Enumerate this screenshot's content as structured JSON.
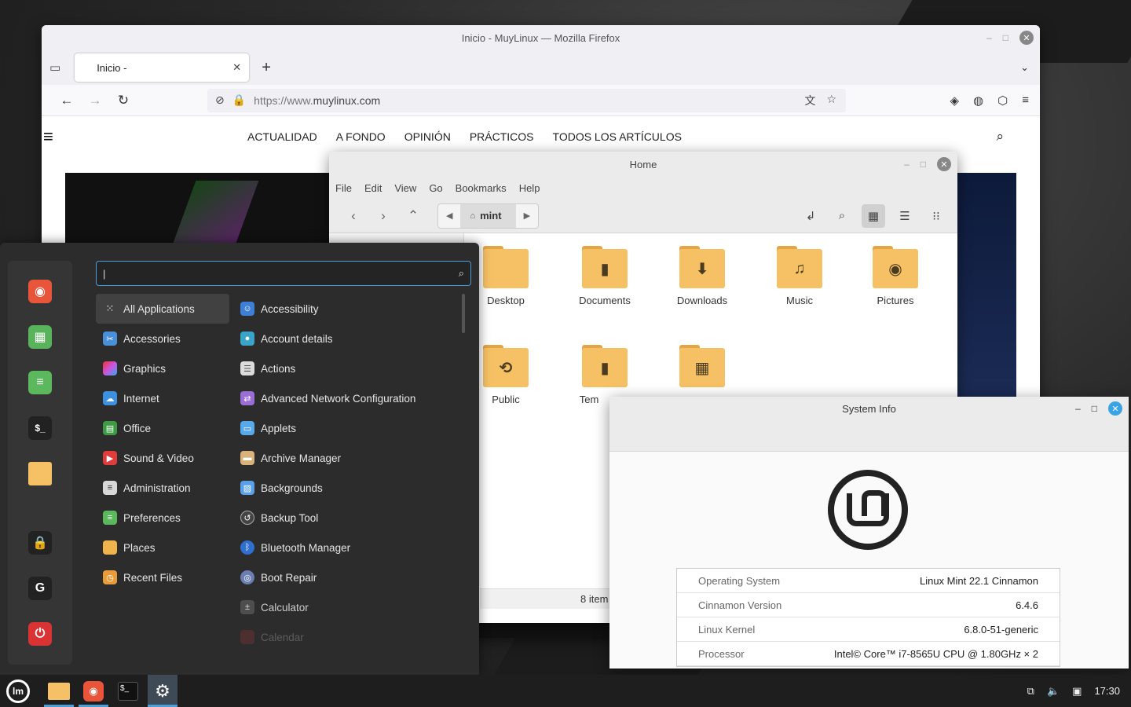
{
  "firefox": {
    "window_title": "Inicio - MuyLinux — Mozilla Firefox",
    "tab_title": "Inicio -",
    "url_proto": "https://www.",
    "url_host": "muylinux.com",
    "site_nav": [
      "ACTUALIDAD",
      "A FONDO",
      "OPINIÓN",
      "PRÁCTICOS",
      "TODOS LOS ARTÍCULOS"
    ]
  },
  "files": {
    "window_title": "Home",
    "menu": [
      "File",
      "Edit",
      "View",
      "Go",
      "Bookmarks",
      "Help"
    ],
    "path_crumb": "mint",
    "items": [
      {
        "label": "Desktop",
        "glyph": ""
      },
      {
        "label": "Documents",
        "glyph": "▮"
      },
      {
        "label": "Downloads",
        "glyph": "⬇"
      },
      {
        "label": "Music",
        "glyph": "♫"
      },
      {
        "label": "Pictures",
        "glyph": "◉"
      },
      {
        "label": "Public",
        "glyph": "⟲"
      },
      {
        "label": "Tem",
        "glyph": "▮"
      },
      {
        "label": "",
        "glyph": "▦"
      }
    ],
    "status": "8 item"
  },
  "sysinfo": {
    "window_title": "System Info",
    "rows": [
      {
        "key": "Operating System",
        "value": "Linux Mint 22.1 Cinnamon"
      },
      {
        "key": "Cinnamon Version",
        "value": "6.4.6"
      },
      {
        "key": "Linux Kernel",
        "value": "6.8.0-51-generic"
      },
      {
        "key": "Processor",
        "value": "Intel© Core™ i7-8565U CPU @ 1.80GHz × 2"
      }
    ]
  },
  "menu": {
    "search_value": "|",
    "categories": [
      {
        "label": "All Applications",
        "icon": "grid-icon",
        "color": "#414141",
        "selected": true
      },
      {
        "label": "Accessories",
        "icon": "scissors-icon",
        "color": "#4a90d9"
      },
      {
        "label": "Graphics",
        "icon": "palette-icon",
        "color": "#c54fd6"
      },
      {
        "label": "Internet",
        "icon": "cloud-icon",
        "color": "#3d8fe0"
      },
      {
        "label": "Office",
        "icon": "document-icon",
        "color": "#3e9a45"
      },
      {
        "label": "Sound & Video",
        "icon": "play-icon",
        "color": "#e03c3c"
      },
      {
        "label": "Administration",
        "icon": "toggle-icon",
        "color": "#d8d8d8"
      },
      {
        "label": "Preferences",
        "icon": "toggle-icon",
        "color": "#5cb85c"
      },
      {
        "label": "Places",
        "icon": "folder-icon",
        "color": "#f0b44c"
      },
      {
        "label": "Recent Files",
        "icon": "folder-icon",
        "color": "#e89b3a"
      }
    ],
    "apps": [
      {
        "label": "Accessibility",
        "icon": "accessibility-icon",
        "color": "#3d7fd6"
      },
      {
        "label": "Account details",
        "icon": "user-icon",
        "color": "#3aa4c8"
      },
      {
        "label": "Actions",
        "icon": "list-icon",
        "color": "#dcdcdc"
      },
      {
        "label": "Advanced Network Configuration",
        "icon": "network-icon",
        "color": "#9b6ed6"
      },
      {
        "label": "Applets",
        "icon": "applets-icon",
        "color": "#57a9ea"
      },
      {
        "label": "Archive Manager",
        "icon": "archive-icon",
        "color": "#d8b27a"
      },
      {
        "label": "Backgrounds",
        "icon": "image-icon",
        "color": "#5aa0e6"
      },
      {
        "label": "Backup Tool",
        "icon": "backup-icon",
        "color": "#444"
      },
      {
        "label": "Bluetooth Manager",
        "icon": "bluetooth-icon",
        "color": "#2f6fd0"
      },
      {
        "label": "Boot Repair",
        "icon": "boot-icon",
        "color": "#6a7fb0"
      },
      {
        "label": "Calculator",
        "icon": "calculator-icon",
        "color": "#555"
      },
      {
        "label": "Calendar",
        "icon": "calendar-icon",
        "color": "#b03a3a"
      }
    ],
    "favorites": [
      {
        "name": "firefox-icon",
        "color": "#e8553a",
        "glyph": "◉"
      },
      {
        "name": "software-manager-icon",
        "color": "#58b35b",
        "glyph": "▦"
      },
      {
        "name": "settings-toggle-icon",
        "color": "#5cb85c",
        "glyph": "≡"
      },
      {
        "name": "terminal-icon",
        "color": "#222",
        "glyph": "$"
      },
      {
        "name": "files-folder-icon",
        "color": "#f5c164",
        "glyph": ""
      },
      {
        "name": "lock-icon",
        "color": "#222",
        "glyph": "🔒"
      },
      {
        "name": "logout-icon",
        "color": "#222",
        "glyph": "G"
      },
      {
        "name": "power-icon",
        "color": "#d93333",
        "glyph": "⏻"
      }
    ]
  },
  "taskbar": {
    "clock": "17:30"
  }
}
